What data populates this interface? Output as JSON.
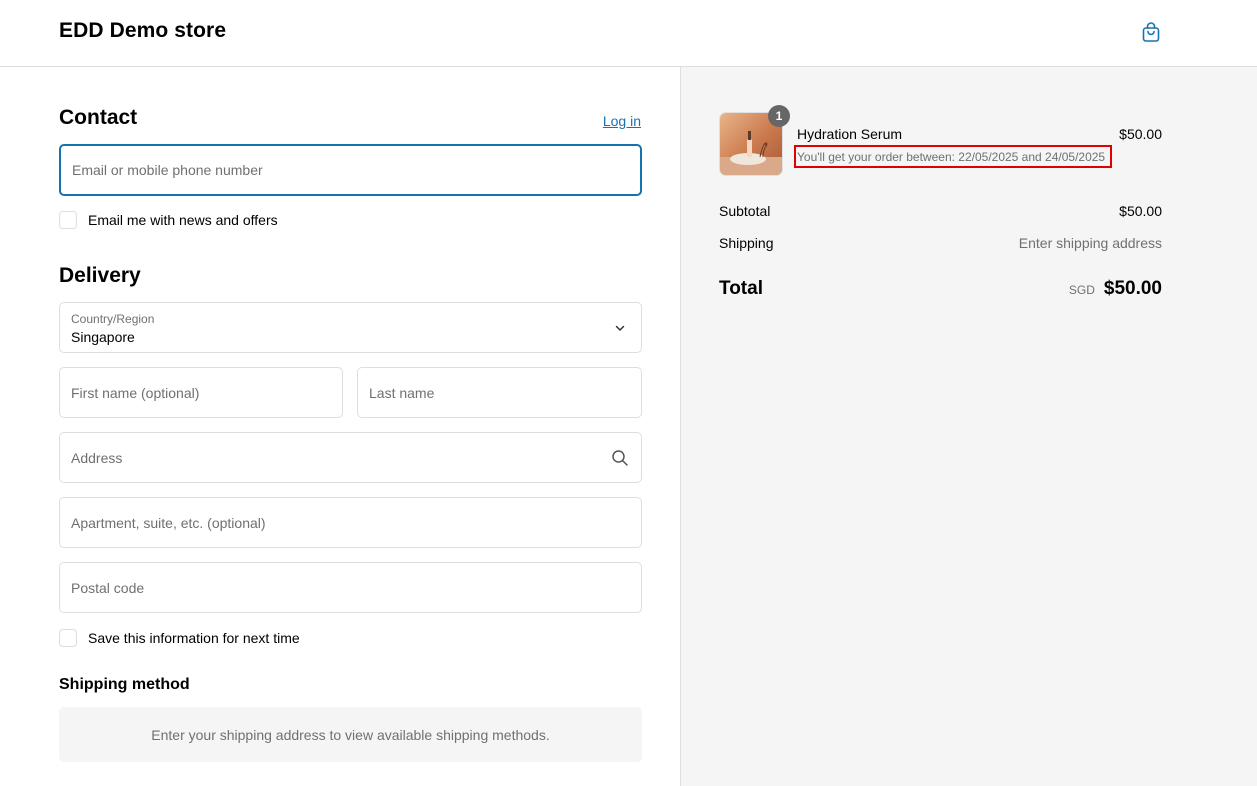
{
  "header": {
    "store_name": "EDD Demo store",
    "cart_icon": "shopping-bag-icon",
    "accent_color": "#1773b0"
  },
  "contact": {
    "title": "Contact",
    "login_label": "Log in",
    "email_placeholder": "Email or mobile phone number",
    "newsletter_label": "Email me with news and offers"
  },
  "delivery": {
    "title": "Delivery",
    "country_label": "Country/Region",
    "country_value": "Singapore",
    "first_name_placeholder": "First name (optional)",
    "last_name_placeholder": "Last name",
    "address_placeholder": "Address",
    "apartment_placeholder": "Apartment, suite, etc. (optional)",
    "postal_placeholder": "Postal code",
    "save_info_label": "Save this information for next time"
  },
  "shipping_method": {
    "title": "Shipping method",
    "message": "Enter your shipping address to view available shipping methods."
  },
  "summary": {
    "product": {
      "name": "Hydration Serum",
      "price": "$50.00",
      "quantity": "1",
      "delivery_note": "You'll get your order between: 22/05/2025 and 24/05/2025"
    },
    "subtotal_label": "Subtotal",
    "subtotal_value": "$50.00",
    "shipping_label": "Shipping",
    "shipping_value": "Enter shipping address",
    "total_label": "Total",
    "total_currency": "SGD",
    "total_value": "$50.00",
    "highlight_color": "#e00000"
  }
}
